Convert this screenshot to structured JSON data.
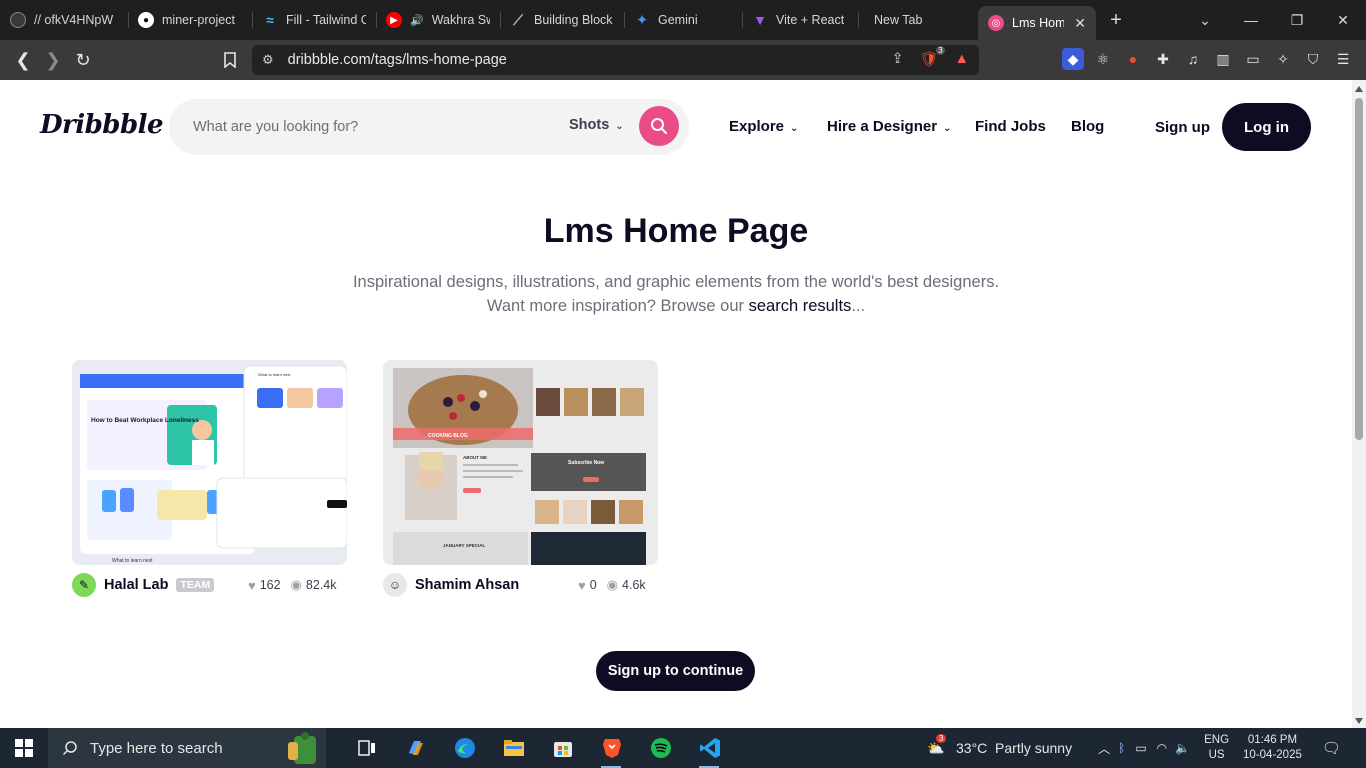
{
  "browser": {
    "tabs": [
      {
        "label": "// ofkV4HNpW",
        "icon": "tab-app-icon",
        "color": "#2b2b2b"
      },
      {
        "label": "miner-project",
        "icon": "github-icon",
        "color": "#ffffff"
      },
      {
        "label": "Fill - Tailwind C",
        "icon": "tailwind-icon",
        "color": "#38bdf8"
      },
      {
        "label": "Wakhra Sw",
        "icon": "youtube-icon",
        "color": "#ff0000"
      },
      {
        "label": "Building Block",
        "icon": "blocks-icon",
        "color": "#bbbbbb"
      },
      {
        "label": "Gemini",
        "icon": "gemini-icon",
        "color": "#4f8ef7"
      },
      {
        "label": "Vite + React",
        "icon": "vite-icon",
        "color": "#a855f7"
      },
      {
        "label": "New Tab",
        "icon": "",
        "color": ""
      },
      {
        "label": "Lms Hom",
        "icon": "dribbble-icon",
        "color": "#ea4c89",
        "active": true
      }
    ],
    "url": "dribbble.com/tags/lms-home-page",
    "brave_badge": "3"
  },
  "site": {
    "logo": "Dribbble",
    "search": {
      "placeholder": "What are you looking for?",
      "scope": "Shots"
    },
    "nav": {
      "explore": "Explore",
      "hire": "Hire a Designer",
      "jobs": "Find Jobs",
      "blog": "Blog",
      "signup": "Sign up",
      "login": "Log in"
    },
    "title": "Lms Home Page",
    "subtitle_line1": "Inspirational designs, illustrations, and graphic elements from the world's best designers.",
    "subtitle_line2_prefix": "Want more inspiration? Browse our ",
    "subtitle_link": "search results",
    "subtitle_suffix": "...",
    "shots": [
      {
        "author": "Halal Lab",
        "badge": "TEAM",
        "likes": "162",
        "views": "82.4k"
      },
      {
        "author": "Shamim Ahsan",
        "badge": "",
        "likes": "0",
        "views": "4.6k"
      }
    ],
    "shot1_text": {
      "heading": "How to Beat Workplace Loneliness",
      "right_title": "What to learn next",
      "bottom": "What to learn next"
    },
    "shot2_text": {
      "about": "ABOUT ME",
      "subscribe": "Subscribe Now",
      "special": "JANUARY SPECIAL",
      "hero": "COOKING BLOG"
    },
    "cta": "Sign up to continue",
    "brand_color": "#ea4c89"
  },
  "taskbar": {
    "search_placeholder": "Type here to search",
    "weather": "33°C  Partly sunny",
    "weather_badge": "3",
    "lang_top": "ENG",
    "lang_bottom": "US",
    "time": "01:46 PM",
    "date": "10-04-2025"
  }
}
